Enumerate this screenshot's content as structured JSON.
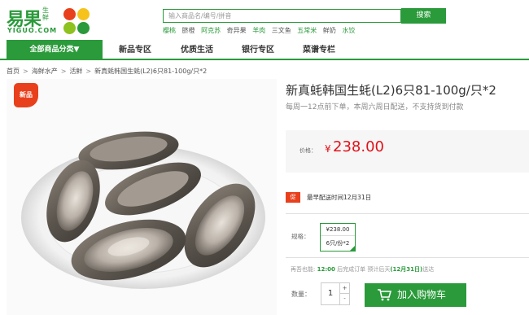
{
  "logo": {
    "cn": "易果",
    "cn_sub": "生鲜",
    "en": "YIGUO.COM",
    "dot_colors": [
      "#e8401c",
      "#f6c21c",
      "#8dc21f",
      "#2a9a3a"
    ]
  },
  "search": {
    "placeholder": "输入商品名/编号/拼音",
    "button_label": "搜索",
    "hot_words": [
      "樱桃",
      "脐橙",
      "阿克苏",
      "奇异果",
      "羊肉",
      "三文鱼",
      "五常米",
      "鲜奶",
      "水饺"
    ]
  },
  "nav": {
    "category_label": "全部商品分类▼",
    "items": [
      "新品专区",
      "优质生活",
      "银行专区",
      "菜谱专栏"
    ]
  },
  "breadcrumb": [
    "首页",
    "海鲜水产",
    "活鲜",
    "新真蚝韩国生蚝(L2)6只81-100g/只*2"
  ],
  "product": {
    "badge": "新品",
    "title": "新真蚝韩国生蚝(L2)6只81-100g/只*2",
    "subtitle": "每周一12点前下单，本周六周日配送，不支持货到付款",
    "price_label": "价格：",
    "price_symbol": "¥",
    "price": "238.00",
    "promo_tag": "促",
    "promo_text": "最早配送时间12月31日",
    "spec_label": "规格：",
    "spec_price": "¥238.00",
    "spec_name": "6只/份*2",
    "delivery_prefix": "再吾也能",
    "delivery_time": "12:00",
    "delivery_mid": "后完成订单 预计后天",
    "delivery_date": "(12月31日)",
    "delivery_suffix": "送达",
    "qty_label": "数量：",
    "qty": "1",
    "qty_up": "+",
    "qty_down": "-",
    "cart_label": "加入购物车"
  },
  "colors": {
    "brand_green": "#2a9a3a",
    "price_red": "#e0121a",
    "badge_red": "#e8401c"
  }
}
